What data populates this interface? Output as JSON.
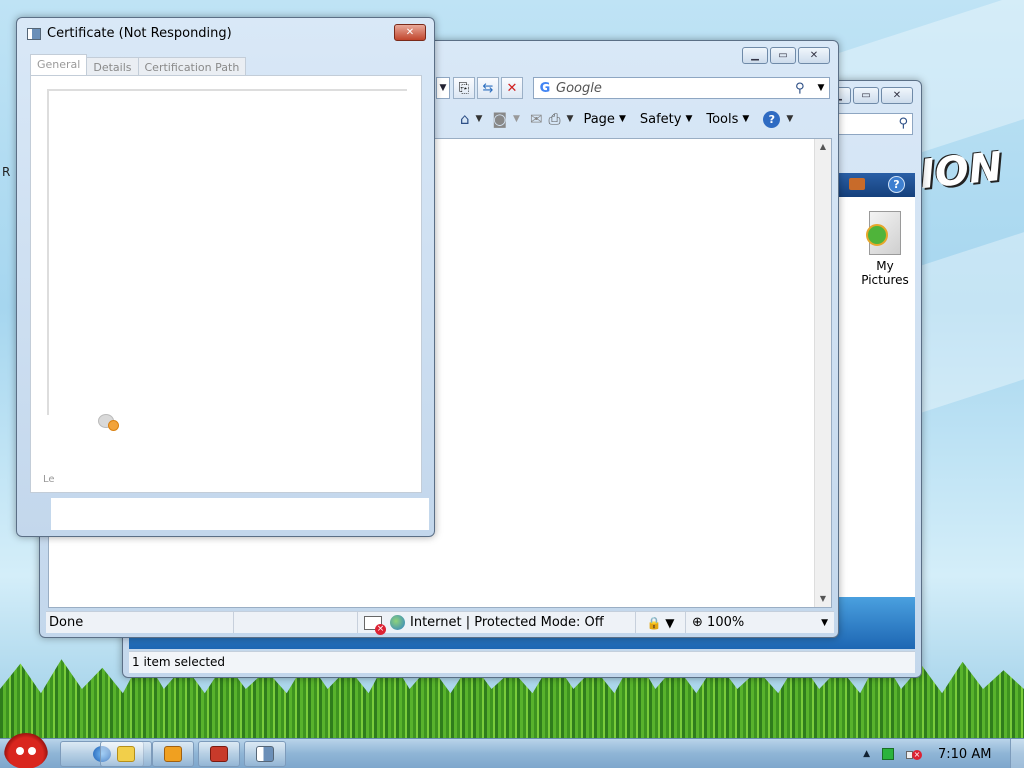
{
  "desktop": {
    "brand_art_text": "ION",
    "side_label": "R"
  },
  "explorer": {
    "search_icon": "search-icon",
    "folder_label": "My\nPictures",
    "status_text": "1 item selected"
  },
  "ie": {
    "address_dropdown": "▼",
    "search_placeholder": "Google",
    "toolbar": {
      "page_label": "Page",
      "safety_label": "Safety",
      "tools_label": "Tools",
      "help_label": "?"
    },
    "status": {
      "done": "Done",
      "zone": "Internet | Protected Mode: Off",
      "zoom": "100%"
    }
  },
  "certificate": {
    "title": "Certificate (Not Responding)",
    "tabs": [
      {
        "label": "General"
      },
      {
        "label": "Details"
      },
      {
        "label": "Certification Path"
      }
    ],
    "partial_text": "Le"
  },
  "taskbar": {
    "clock": "7:10 AM"
  },
  "colors": {
    "accent": "#2d4f86",
    "close_red": "#c0452c",
    "taskbar": "#8fb5d6"
  }
}
